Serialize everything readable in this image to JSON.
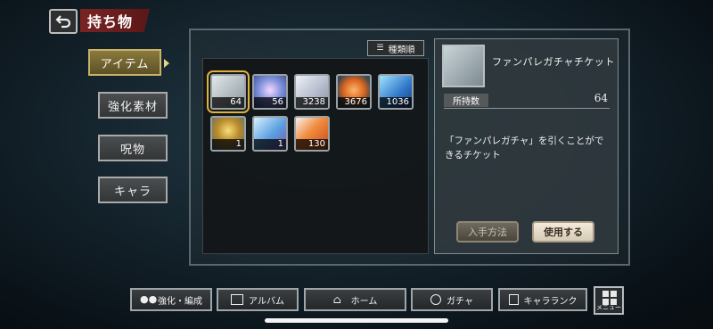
{
  "header": {
    "title": "持ち物"
  },
  "tabs": [
    {
      "label": "アイテム",
      "active": true
    },
    {
      "label": "強化素材"
    },
    {
      "label": "呪物"
    },
    {
      "label": "キャラ"
    }
  ],
  "sort": {
    "label": "種類順"
  },
  "items": [
    {
      "name": "ticket-silver",
      "count": "64",
      "selected": true,
      "color": "#bfc7cc"
    },
    {
      "name": "stone-rainbow",
      "count": "56",
      "color": "#a79bd6"
    },
    {
      "name": "dice-pack",
      "count": "3238",
      "color": "#c9d0e0"
    },
    {
      "name": "orange-leaves",
      "count": "3676",
      "color": "#e07b35"
    },
    {
      "name": "blue-crystal",
      "count": "1036",
      "color": "#3f8fe0"
    },
    {
      "name": "gold-medal",
      "count": "1",
      "color": "#c9a23a"
    },
    {
      "name": "blue-ticket",
      "count": "1",
      "color": "#5a9ee0"
    },
    {
      "name": "orange-card",
      "count": "130",
      "color": "#e06b2b"
    }
  ],
  "detail": {
    "name": "ファンパレガチャチケット",
    "qty_label": "所持数",
    "qty_value": "64",
    "description": "「ファンパレガチャ」を引くことができるチケット",
    "acquire_label": "入手方法",
    "use_label": "使用する"
  },
  "nav": [
    {
      "label": "強化・編成",
      "icon": "party-icon"
    },
    {
      "label": "アルバム",
      "icon": "album-icon"
    },
    {
      "label": "ホーム",
      "icon": "home-icon"
    },
    {
      "label": "ガチャ",
      "icon": "gacha-icon"
    },
    {
      "label": "キャラランク",
      "icon": "rank-icon"
    }
  ],
  "menu": {
    "label": "メニュー"
  }
}
